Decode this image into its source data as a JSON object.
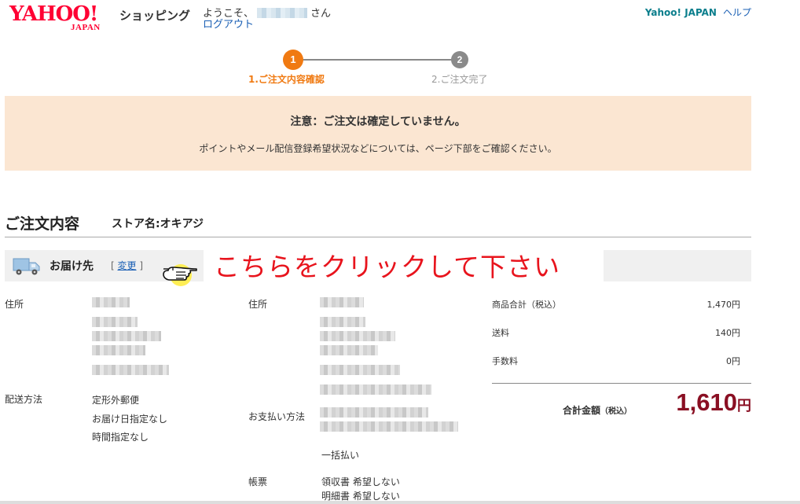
{
  "header": {
    "logo_text": "YAHOO!",
    "logo_sub": "JAPAN",
    "service_name": "ショッピング",
    "welcome_prefix": "ようこそ、",
    "welcome_suffix": "さん",
    "logout_label": "ログアウト",
    "yahoo_japan_link": "Yahoo! JAPAN",
    "help_link": "ヘルプ"
  },
  "steps": [
    {
      "number": "1",
      "label": "1.ご注文内容確認",
      "active": true
    },
    {
      "number": "2",
      "label": "2.ご注文完了",
      "active": false
    }
  ],
  "notice": {
    "title": "注意：ご注文は確定していません。",
    "subtitle": "ポイントやメール配信登録希望状況などについては、ページ下部をご確認ください。"
  },
  "order": {
    "heading": "ご注文内容",
    "store_name": "ストア名:オキアジ"
  },
  "delivery": {
    "label": "お届け先",
    "change_open": "[",
    "change_link": "変更",
    "change_close": "]",
    "callout": "こちらをクリックして下さい"
  },
  "shipping_column": {
    "address_label": "住所",
    "method_label": "配送方法",
    "method_lines": [
      "定形外郵便",
      "お届け日指定なし",
      "時間指定なし"
    ]
  },
  "billing_column": {
    "address_label": "住所",
    "payment_label": "お支払い方法",
    "payment_type": "一括払い",
    "receipt_label": "帳票",
    "receipt_lines": [
      "領収書 希望しない",
      "明細書 希望しない"
    ]
  },
  "summary": {
    "rows": [
      {
        "label": "商品合計（税込）",
        "value": "1,470円"
      },
      {
        "label": "送料",
        "value": "140円"
      },
      {
        "label": "手数料",
        "value": "0円"
      }
    ],
    "total_label": "合計金額",
    "total_note": "（税込）",
    "total_value": "1,610",
    "total_unit": "円"
  },
  "colors": {
    "brand_red": "#ff0033",
    "step_active": "#f07a12",
    "notice_bg": "#fbe6d2",
    "callout_red": "#e8141d",
    "total_red": "#8a0f23",
    "link_blue": "#1a5fb4"
  }
}
